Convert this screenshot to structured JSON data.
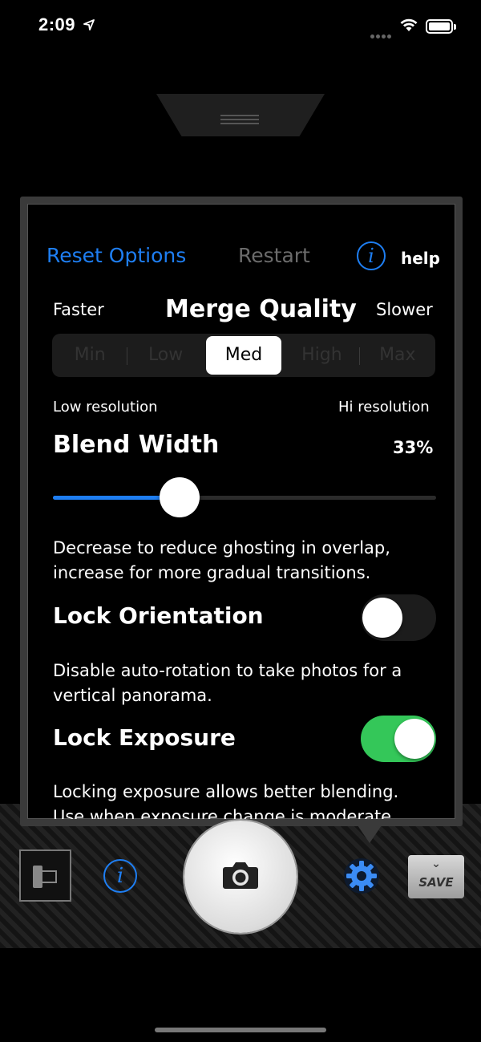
{
  "status_bar": {
    "time": "2:09"
  },
  "header": {
    "reset_label": "Reset Options",
    "restart_label": "Restart",
    "info_glyph": "i",
    "help_label": "help"
  },
  "merge_quality": {
    "title": "Merge Quality",
    "left_label": "Faster",
    "right_label": "Slower",
    "options": [
      "Min",
      "Low",
      "Med",
      "High",
      "Max"
    ],
    "selected": "Med"
  },
  "blend_width": {
    "low_label": "Low resolution",
    "high_label": "Hi resolution",
    "title": "Blend Width",
    "value_text": "33%",
    "value_fraction": 0.33,
    "description": "Decrease to reduce ghosting in overlap, increase for more gradual transitions."
  },
  "lock_orientation": {
    "title": "Lock Orientation",
    "enabled": false,
    "description": "Disable auto-rotation to take photos for a vertical panorama."
  },
  "lock_exposure": {
    "title": "Lock Exposure",
    "enabled": true,
    "description": "Locking exposure allows better blending. Use when exposure change is moderate."
  },
  "toolbar": {
    "info_glyph": "i",
    "save_label": "SAVE",
    "icons": [
      "film-roll-icon",
      "info-icon",
      "camera-icon",
      "gear-icon",
      "save-chevron-icon"
    ]
  },
  "colors": {
    "accent_blue": "#1e7ef2",
    "toggle_on": "#34c759",
    "panel_border": "#3a3a3a"
  }
}
